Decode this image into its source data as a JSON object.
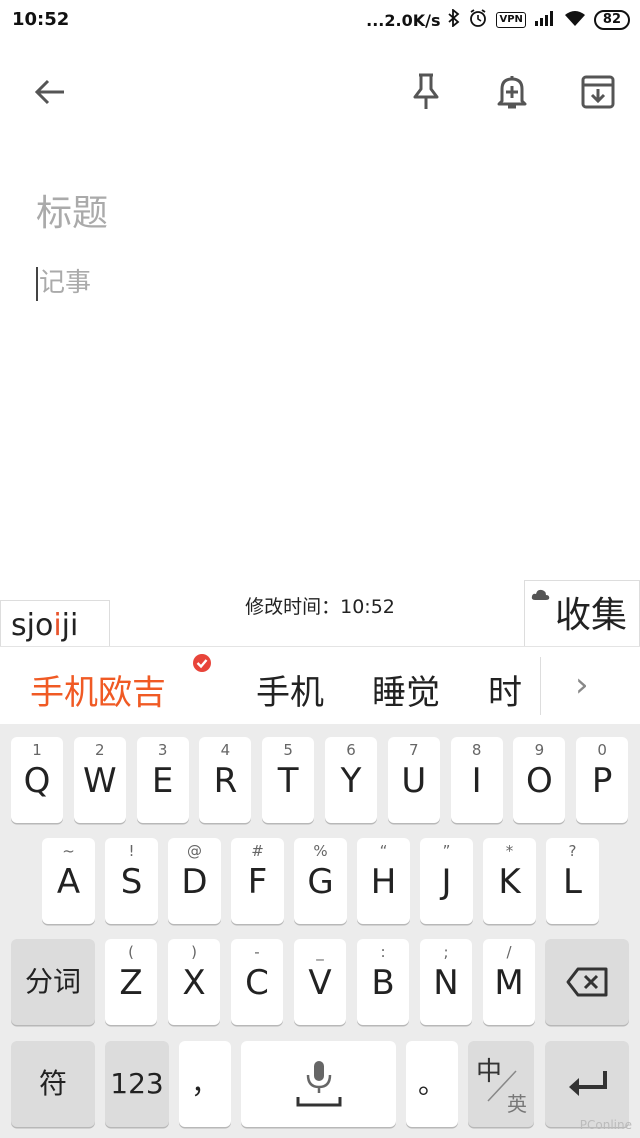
{
  "status": {
    "time": "10:52",
    "net_speed": "...2.0K/s",
    "vpn": "VPN",
    "battery": "82"
  },
  "editor": {
    "title_placeholder": "标题",
    "body_placeholder": "记事",
    "modified": "修改时间：10:52"
  },
  "ime": {
    "composition": {
      "pre": "sjo",
      "hl": "i",
      "post": "ji"
    },
    "collect": "收集",
    "candidates": [
      "手机欧吉",
      "手机",
      "睡觉",
      "时间"
    ]
  },
  "keyboard": {
    "row1": [
      {
        "main": "Q",
        "sub": "1"
      },
      {
        "main": "W",
        "sub": "2"
      },
      {
        "main": "E",
        "sub": "3"
      },
      {
        "main": "R",
        "sub": "4"
      },
      {
        "main": "T",
        "sub": "5"
      },
      {
        "main": "Y",
        "sub": "6"
      },
      {
        "main": "U",
        "sub": "7"
      },
      {
        "main": "I",
        "sub": "8"
      },
      {
        "main": "O",
        "sub": "9"
      },
      {
        "main": "P",
        "sub": "0"
      }
    ],
    "row2": [
      {
        "main": "A",
        "sub": "~"
      },
      {
        "main": "S",
        "sub": "!"
      },
      {
        "main": "D",
        "sub": "@"
      },
      {
        "main": "F",
        "sub": "#"
      },
      {
        "main": "G",
        "sub": "%"
      },
      {
        "main": "H",
        "sub": "“"
      },
      {
        "main": "J",
        "sub": "”"
      },
      {
        "main": "K",
        "sub": "*"
      },
      {
        "main": "L",
        "sub": "?"
      }
    ],
    "row3": [
      {
        "main": "Z",
        "sub": "("
      },
      {
        "main": "X",
        "sub": ")"
      },
      {
        "main": "C",
        "sub": "-"
      },
      {
        "main": "V",
        "sub": "_"
      },
      {
        "main": "B",
        "sub": ":"
      },
      {
        "main": "N",
        "sub": ";"
      },
      {
        "main": "M",
        "sub": "/"
      }
    ],
    "fenci": "分词",
    "symbols": "符",
    "numbers": "123",
    "comma": "，",
    "period": "。",
    "lang_top": "中",
    "lang_bottom": "英"
  },
  "watermark": "PConline",
  "colors": {
    "accent": "#f05a24",
    "check": "#e8443a"
  }
}
